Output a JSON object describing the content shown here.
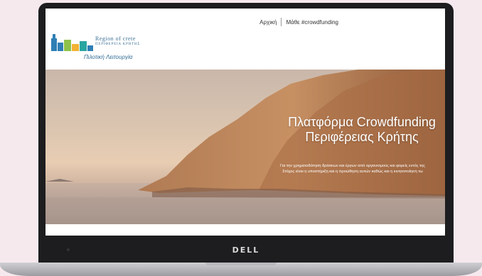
{
  "nav": {
    "home": "Αρχική",
    "learn": "Μάθε #crowdfunding"
  },
  "logo": {
    "title": "Region of crete",
    "subtitle": "ΠΕΡΙΦΕΡΕΙΑ ΚΡΗΤΗΣ",
    "tagline": "Πιλοτική Λειτουργία"
  },
  "hero": {
    "title_line1": "Πλατφόρμα Crowdfunding",
    "title_line2": "Περιφέρειας Κρήτης",
    "subtitle_line1": "Για την χρηματοδότηση δράσεων και έργων από οργανισμούς και φορείς εντός της",
    "subtitle_line2": "Στόχος είναι η υποστήριξη και η προώθηση αυτών καθώς και η κινητοποίηση τω"
  },
  "device": {
    "brand": "DELL"
  },
  "colors": {
    "logo_blue": "#3a6f95",
    "logo_mark_colors": [
      "#2f7fb5",
      "#8fc24a",
      "#f2b233",
      "#2aa6a0"
    ]
  }
}
